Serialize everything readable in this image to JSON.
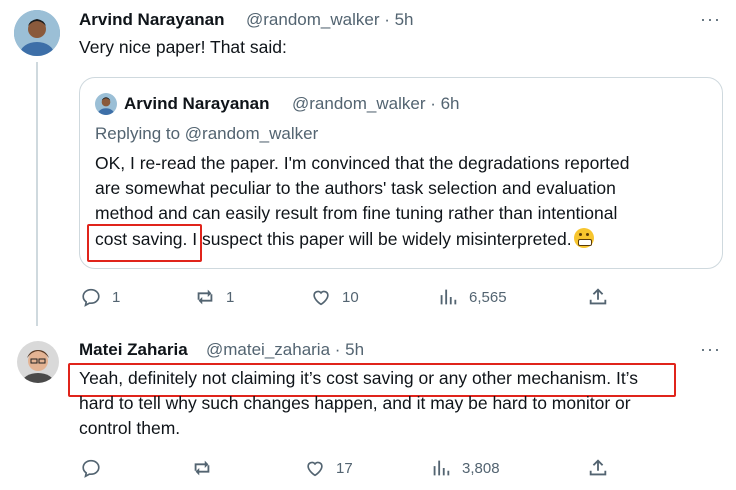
{
  "tweet1": {
    "author_name": "Arvind Narayanan",
    "handle_time": "@random_walker · 5h",
    "text": "Very nice paper! That said:",
    "more": "···",
    "quote": {
      "author_name": "Arvind Narayanan",
      "handle_time": "@random_walker · 6h",
      "replying": "Replying to @random_walker",
      "line1": "OK, I re-read the paper. I'm convinced that the degradations reported",
      "line2": "are somewhat peculiar to the authors' task selection and evaluation",
      "line3": "method and can easily result from fine tuning rather than intentional",
      "line4_highlight": "cost saving.",
      "line4_rest": " I suspect this paper will be widely misinterpreted."
    },
    "actions": {
      "replies": "1",
      "retweets": "1",
      "likes": "10",
      "views": "6,565"
    }
  },
  "tweet2": {
    "author_name": "Matei Zaharia",
    "handle_time": "@matei_zaharia · 5h",
    "more": "···",
    "line1_highlight": "Yeah, definitely not claiming it’s cost saving or any other mechanism.",
    "line1_rest": " It’s",
    "line2": "hard to tell why such changes happen, and it may be hard to monitor or",
    "line3": "control them.",
    "actions": {
      "replies": "",
      "retweets": "",
      "likes": "17",
      "views": "3,808"
    }
  },
  "colors": {
    "text": "#0f1419",
    "muted": "#536471",
    "highlight_border": "#e0241b",
    "border": "#cfd9de"
  }
}
